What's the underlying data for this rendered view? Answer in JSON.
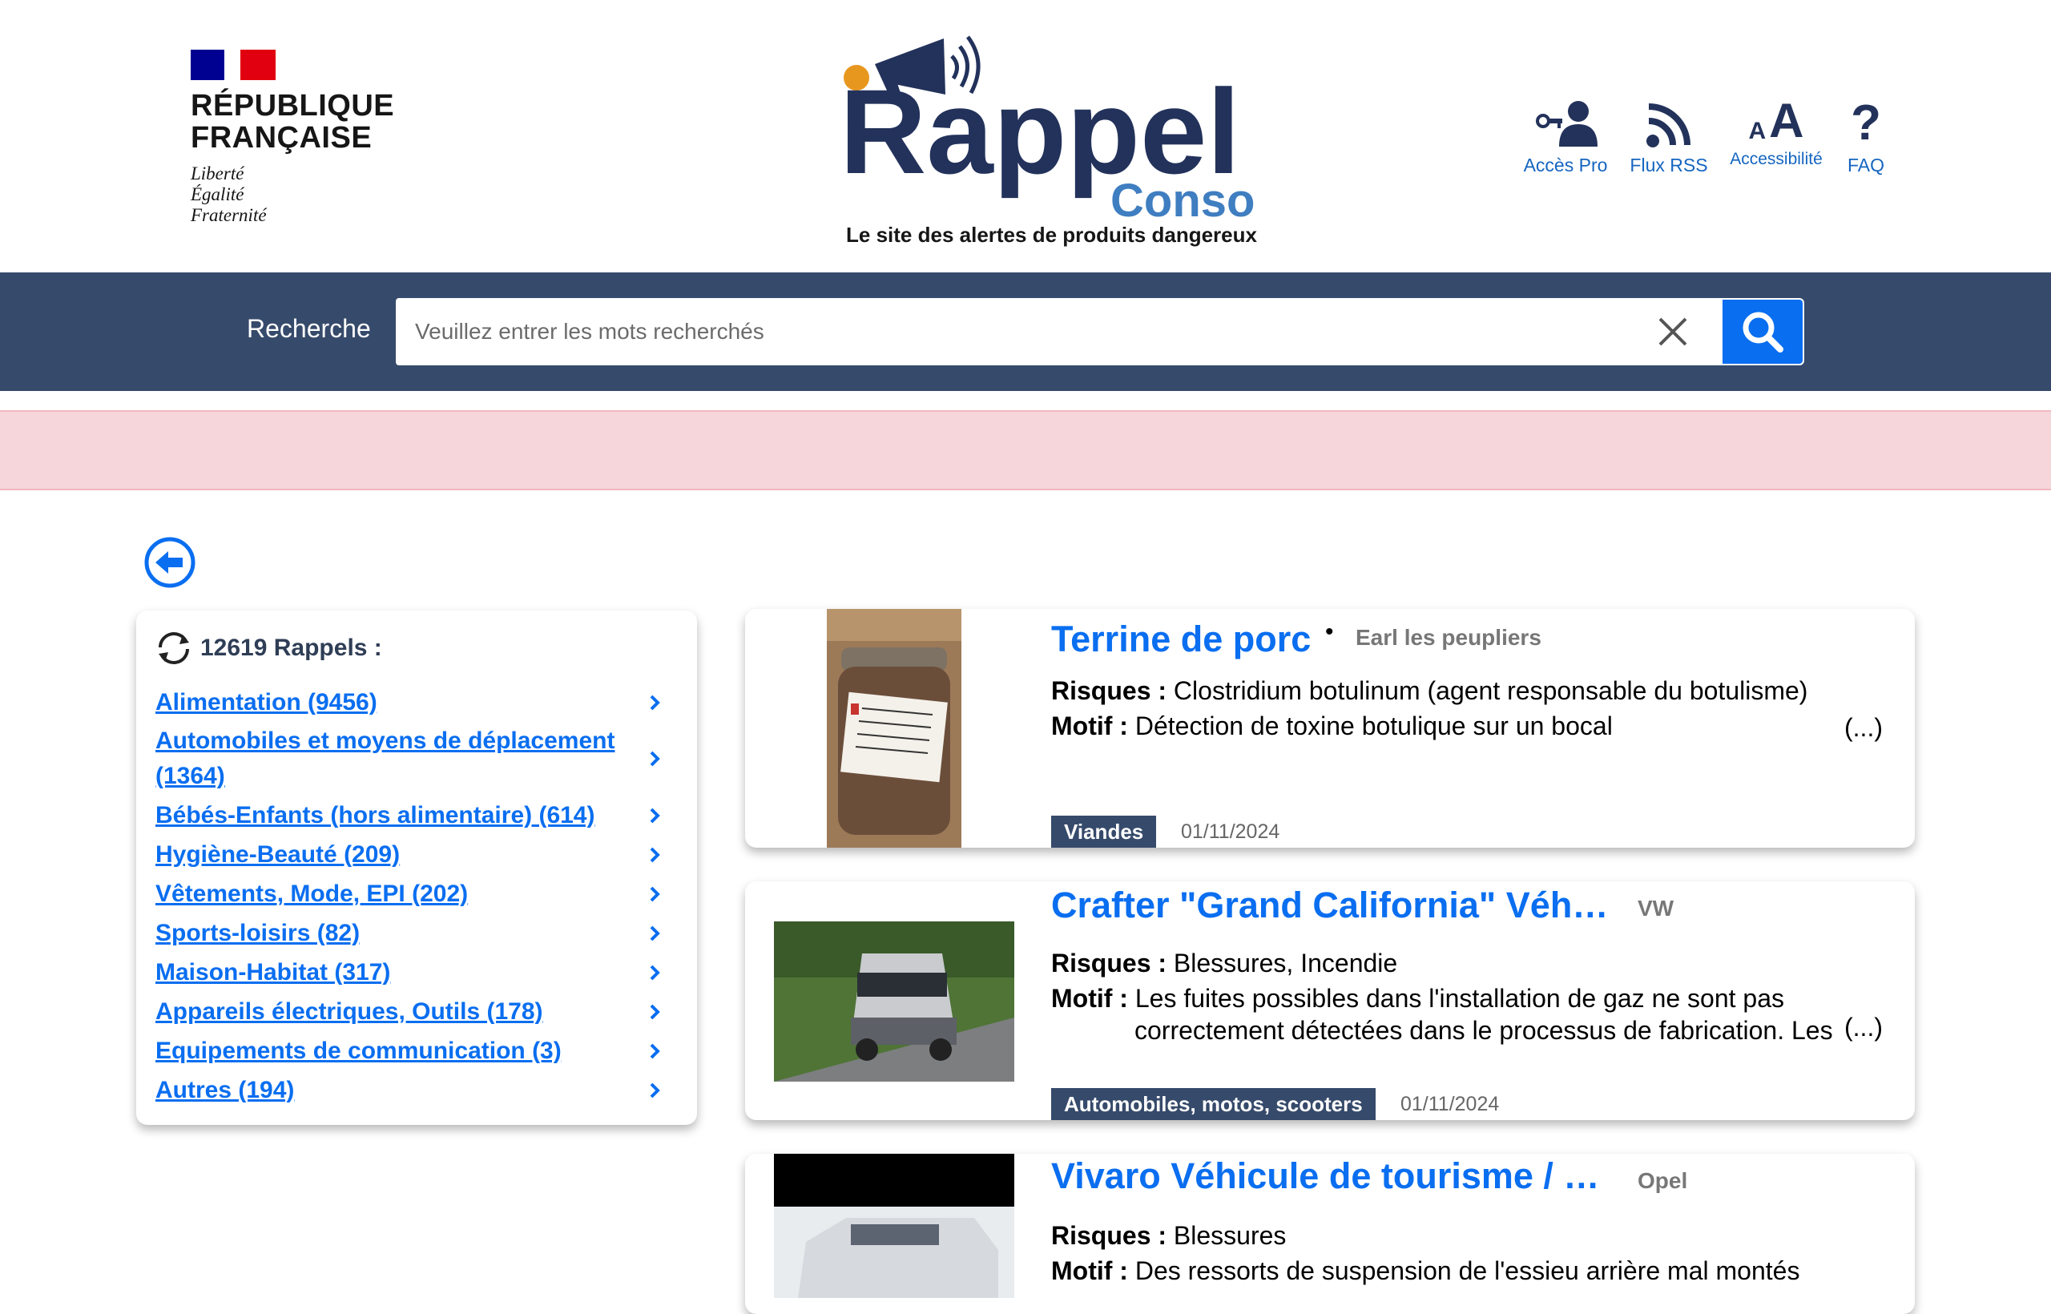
{
  "header": {
    "rf": {
      "line1": "RÉPUBLIQUE",
      "line2": "FRANÇAISE",
      "motto1": "Liberté",
      "motto2": "Égalité",
      "motto3": "Fraternité"
    },
    "logo": {
      "word1": "Rappel",
      "word2": "Conso",
      "tagline": "Le site des alertes de produits dangereux"
    },
    "tools": [
      {
        "label": "Accès Pro",
        "icon": "key-user-icon"
      },
      {
        "label": "Flux RSS",
        "icon": "rss-icon"
      },
      {
        "label": "Accessibilité",
        "icon": "text-size-icon"
      },
      {
        "label": "FAQ",
        "icon": "question-icon"
      }
    ]
  },
  "search": {
    "label": "Recherche",
    "placeholder": "Veuillez entrer les mots recherchés",
    "value": ""
  },
  "sidebar": {
    "count": "12619 Rappels  :",
    "items": [
      {
        "label": "Alimentation (9456)"
      },
      {
        "label": "Automobiles et moyens de déplacement (1364)"
      },
      {
        "label": "Bébés-Enfants (hors alimentaire) (614)"
      },
      {
        "label": "Hygiène-Beauté (209)"
      },
      {
        "label": "Vêtements, Mode, EPI (202)"
      },
      {
        "label": "Sports-loisirs (82)"
      },
      {
        "label": "Maison-Habitat (317)"
      },
      {
        "label": "Appareils électriques, Outils (178)"
      },
      {
        "label": "Equipements de communication (3)"
      },
      {
        "label": "Autres (194)"
      }
    ]
  },
  "results": [
    {
      "title": "Terrine de porc",
      "brand": "Earl les peupliers",
      "risques_label": "Risques :",
      "risques": "Clostridium botulinum (agent responsable du botulisme)",
      "motif_label": "Motif :",
      "motif": "Détection de toxine botulique sur un bocal",
      "more": "(...)",
      "category": "Viandes",
      "date": "01/11/2024"
    },
    {
      "title": "Crafter \"Grand California\" Véhicule de loisirs",
      "brand": "VW",
      "risques_label": "Risques :",
      "risques": "Blessures, Incendie",
      "motif_label": "Motif :",
      "motif": "Les fuites possibles dans l'installation de gaz ne sont pas",
      "motif2": "correctement détectées dans le processus de fabrication. Les",
      "more": "(...)",
      "category": "Automobiles, motos, scooters",
      "date": "01/11/2024"
    },
    {
      "title": "Vivaro Véhicule de tourisme / Véhicule utilitaire",
      "brand": "Opel",
      "risques_label": "Risques :",
      "risques": "Blessures",
      "motif_label": "Motif :",
      "motif": "Des ressorts de suspension de l'essieu arrière mal montés"
    }
  ],
  "colors": {
    "navy": "#364a6b",
    "accent": "#0a6ef0",
    "alert_bg": "#f7d6db"
  }
}
